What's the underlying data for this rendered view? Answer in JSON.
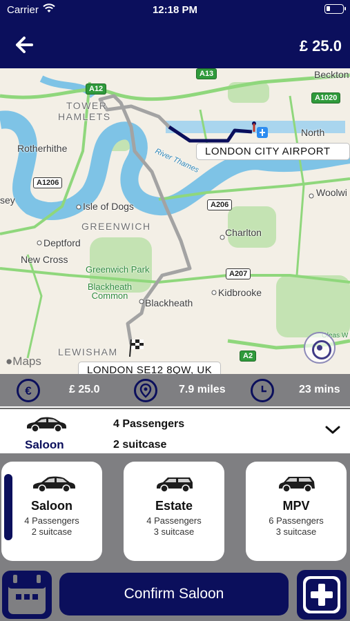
{
  "status_bar": {
    "carrier": "Carrier",
    "time": "12:18 PM"
  },
  "header": {
    "price": "£ 25.0"
  },
  "map": {
    "labels": {
      "tower_hamlets_1": "TOWER",
      "tower_hamlets_2": "HAMLETS",
      "rotherhithe": "Rotherhithe",
      "isle_of_dogs": "Isle of Dogs",
      "greenwich": "GREENWICH",
      "deptford": "Deptford",
      "new_cross": "New Cross",
      "greenwich_park": "Greenwich Park",
      "blackheath_common_1": "Blackheath",
      "blackheath_common_2": "Common",
      "blackheath": "Blackheath",
      "lewisham": "LEWISHAM",
      "charlton": "Charlton",
      "kidbrooke": "Kidbrooke",
      "beckton": "Beckton",
      "north_woolwich": "North",
      "woolwich": "Woolwi",
      "sey": "sey",
      "river_thames": "River Thames",
      "maps": "Maps",
      "edge_cut": "Oleas W",
      "edge_cut2": "Woolwi"
    },
    "road_shields": {
      "a12": "A12",
      "a13": "A13",
      "a1020": "A1020",
      "a1206": "A1206",
      "a206": "A206",
      "a207": "A207",
      "a2": "A2"
    },
    "pickup_label": "LONDON CITY AIRPORT",
    "dropoff_label": "LONDON SE12 8QW, UK",
    "route_color": "#a3a3a3",
    "route_end_color": "#0b0f5c",
    "water_color": "#7ec3e6",
    "park_color": "#c4e3b3",
    "major_road_color": "#8fd77c"
  },
  "trip_info": {
    "price": "£ 25.0",
    "distance": "7.9 miles",
    "duration": "23 mins",
    "icons": [
      "euro-icon",
      "location-pin-icon",
      "clock-icon"
    ]
  },
  "selected_vehicle": {
    "name": "Saloon",
    "passengers": "4 Passengers",
    "suitcases": "2 suitcase"
  },
  "vehicles": [
    {
      "name": "Saloon",
      "passengers": "4 Passengers",
      "suitcases": "2 suitcase"
    },
    {
      "name": "Estate",
      "passengers": "4 Passengers",
      "suitcases": "3 suitcase"
    },
    {
      "name": "MPV",
      "passengers": "6 Passengers",
      "suitcases": "3 suitcase"
    }
  ],
  "confirm_button": {
    "label": "Confirm Saloon"
  },
  "colors": {
    "brand": "#0b0f5c",
    "strip": "#7f7f82"
  }
}
